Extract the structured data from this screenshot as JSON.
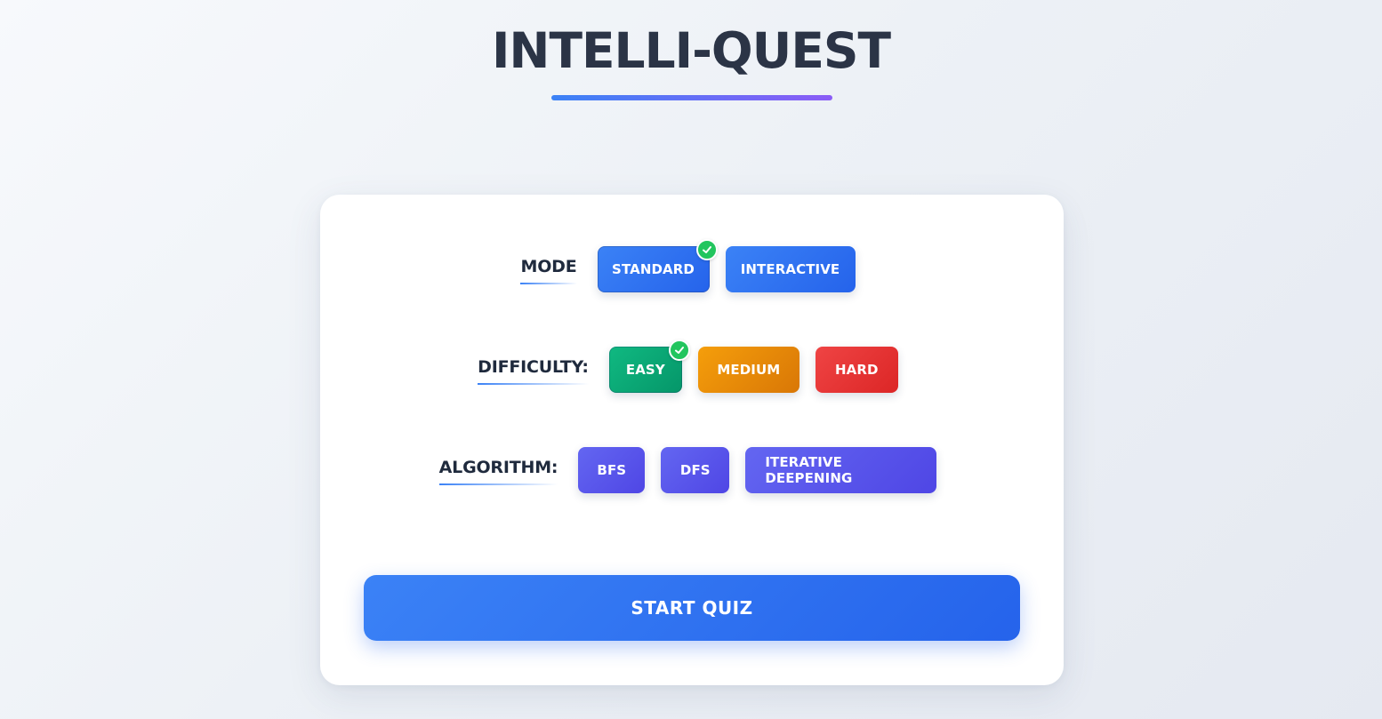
{
  "app": {
    "title": "INTELLI-QUEST"
  },
  "mode": {
    "label": "MODE",
    "options": [
      {
        "label": "STANDARD",
        "selected": true,
        "color": "#3b82f6"
      },
      {
        "label": "INTERACTIVE",
        "selected": false,
        "color": "#3b82f6"
      }
    ]
  },
  "difficulty": {
    "label": "DIFFICULTY:",
    "options": [
      {
        "label": "EASY",
        "selected": true,
        "color": "#10b981"
      },
      {
        "label": "MEDIUM",
        "selected": false,
        "color": "#f59e0b"
      },
      {
        "label": "HARD",
        "selected": false,
        "color": "#ef4444"
      }
    ]
  },
  "algorithm": {
    "label": "ALGORITHM:",
    "options": [
      {
        "label": "BFS",
        "selected": false,
        "color": "#6366f1"
      },
      {
        "label": "DFS",
        "selected": false,
        "color": "#6366f1"
      },
      {
        "label": "ITERATIVE DEEPENING",
        "selected": false,
        "color": "#6366f1"
      }
    ]
  },
  "actions": {
    "start_label": "START QUIZ"
  },
  "colors": {
    "accent_blue": "#3b82f6",
    "accent_purple": "#8b5cf6",
    "check_green": "#22c55e",
    "title_text": "#2b3446"
  },
  "icons": {
    "selected_indicator": "checkmark-icon"
  }
}
